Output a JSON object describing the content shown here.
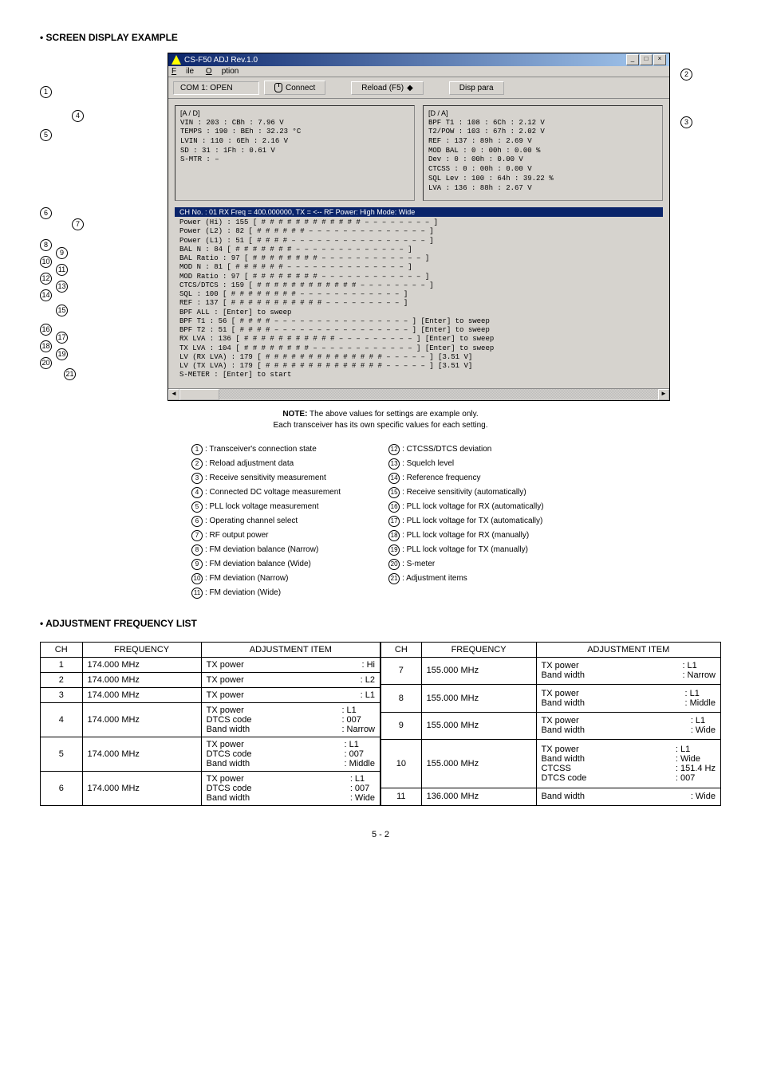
{
  "headings": {
    "screen_example": "• SCREEN DISPLAY EXAMPLE",
    "adjustment_list": "• ADJUSTMENT FREQUENCY LIST"
  },
  "window": {
    "title": "CS-F50 ADJ Rev.1.0",
    "menu": {
      "file": "File",
      "option": "Option"
    },
    "toolbar": {
      "com_status": "COM 1: OPEN",
      "connect": "Connect",
      "reload": "Reload (F5)",
      "disp_para": "Disp  para"
    },
    "panel_left": {
      "header": "[A / D]",
      "lines": [
        "VIN    : 203 : CBh :  7.96 V",
        "TEMPS : 190 : BEh :  32.23 °C",
        "LVIN   : 110 : 6Eh :   2.16 V",
        "SD     :  31 : 1Fh :   0.61 V",
        "S-MTR :  –"
      ]
    },
    "panel_right": {
      "header": "[D / A]",
      "lines": [
        "BPF T1   : 108 : 6Ch :   2.12 V",
        "T2/POW   : 103 : 67h :   2.02 V",
        "REF      : 137 : 89h :   2.69 V",
        "MOD BAL :    0 :  00h :   0.00 %",
        "Dev      :    0 :  00h :   0.00 V",
        "CTCSS    :    0 :  00h :   0.00 V",
        "SQL Lev  : 100 :  64h :  39.22 %",
        "LVA      : 136 :  88h :   2.67 V"
      ]
    },
    "ch_bar": "CH No.    : 01 RX Freq = 400.000000,   TX =          <--       RF Power: High    Mode: Wide",
    "listing": [
      "Power (Hi)  : 155  [ # # # # # # # # # # # # – – – – – – – – ]",
      "Power (L2)  :  82  [ # # # # # # – – – – – – – – – – – – – – ]",
      "Power (L1)  :  51  [ # # # # – – – – – – – – – – – – – – – – ]",
      "BAL N   :  84  [ # # # # # # # – – – – – – – – – – – – – ]",
      "BAL Ratio  :  97  [ # # # # # # # # – – – – – – – – – – – – ]",
      "MOD N   :  81  [ # # # # # # – – – – – – – – – – – – – – ]",
      "MOD Ratio  :  97  [ # # # # # # # # – – – – – – – – – – – – ]",
      "CTCS/DTCS  : 159  [ # # # # # # # # # # # # – – – – – – – – ]",
      "SQL  : 100  [ # # # # # # # # – – – – – – – – – – – – ]",
      "REF  : 137  [ # # # # # # # # # # # – – – – – – – – – ]",
      "BPF ALL  : [Enter]  to  sweep",
      "BPF T1  :  56  [ # # # # – – – – – – – – – – – – – – – – ]  [Enter]  to  sweep",
      "BPF T2  :  51  [ # # # # – – – – – – – – – – – – – – – – ]  [Enter]  to  sweep",
      "RX LVA  : 136  [ # # # # # # # # # # # – – – – – – – – – ]  [Enter]  to  sweep",
      "TX LVA  : 104  [ # # # # # # # # – – – – – – – – – – – – ]  [Enter]  to  sweep",
      "LV (RX LVA)  : 179  [ # # # # # # # # # # # # # # – – – – – ]  [3.51 V]",
      "LV (TX LVA)  : 179  [ # # # # # # # # # # # # # # – – – – – ]  [3.51 V]",
      "S-METER  : [Enter]  to  start"
    ]
  },
  "note": {
    "label": "NOTE:",
    "l1": "The above values for settings are example only.",
    "l2": "Each transceiver has its own specific values for each setting."
  },
  "legend": {
    "left": [
      ": Transceiver's connection state",
      ": Reload adjustment data",
      ": Receive sensitivity measurement",
      ": Connected DC voltage measurement",
      ": PLL lock voltage measurement",
      ": Operating channel select",
      ": RF output power",
      ": FM deviation balance (Narrow)",
      ": FM deviation balance (Wide)",
      ": FM deviation (Narrow)",
      ": FM deviation (Wide)"
    ],
    "right": [
      ": CTCSS/DTCS deviation",
      ": Squelch level",
      ": Reference frequency",
      ": Receive sensitivity (automatically)",
      ": PLL lock voltage for RX (automatically)",
      ": PLL lock voltage for TX (automatically)",
      ": PLL lock voltage for RX (manually)",
      ": PLL lock voltage for TX (manually)",
      ": S-meter",
      ": Adjustment items"
    ]
  },
  "table": {
    "headers": {
      "ch": "CH",
      "freq": "FREQUENCY",
      "adj": "ADJUSTMENT ITEM"
    },
    "left_rows": [
      {
        "ch": "1",
        "freq": "174.000 MHz",
        "labels": "TX power",
        "vals": ": Hi"
      },
      {
        "ch": "2",
        "freq": "174.000 MHz",
        "labels": "TX power",
        "vals": ": L2"
      },
      {
        "ch": "3",
        "freq": "174.000 MHz",
        "labels": "TX power",
        "vals": ": L1"
      },
      {
        "ch": "4",
        "freq": "174.000 MHz",
        "labels": "TX power\nDTCS code\nBand width",
        "vals": ": L1\n: 007\n: Narrow"
      },
      {
        "ch": "5",
        "freq": "174.000 MHz",
        "labels": "TX power\nDTCS code\nBand width",
        "vals": ": L1\n: 007\n: Middle"
      },
      {
        "ch": "6",
        "freq": "174.000 MHz",
        "labels": "TX power\nDTCS code\nBand width",
        "vals": ": L1\n: 007\n: Wide"
      }
    ],
    "right_rows": [
      {
        "ch": "7",
        "freq": "155.000 MHz",
        "labels": "TX power\nBand width",
        "vals": ": L1\n: Narrow"
      },
      {
        "ch": "8",
        "freq": "155.000 MHz",
        "labels": "TX power\nBand width",
        "vals": ": L1\n: Middle"
      },
      {
        "ch": "9",
        "freq": "155.000 MHz",
        "labels": "TX power\nBand width",
        "vals": ": L1\n: Wide"
      },
      {
        "ch": "10",
        "freq": "155.000 MHz",
        "labels": "TX power\nBand width\nCTCSS\nDTCS code",
        "vals": ": L1\n: Wide\n: 151.4 Hz\n: 007"
      },
      {
        "ch": "11",
        "freq": "136.000 MHz",
        "labels": "Band width",
        "vals": ": Wide"
      }
    ]
  },
  "page_num": "5 - 2"
}
